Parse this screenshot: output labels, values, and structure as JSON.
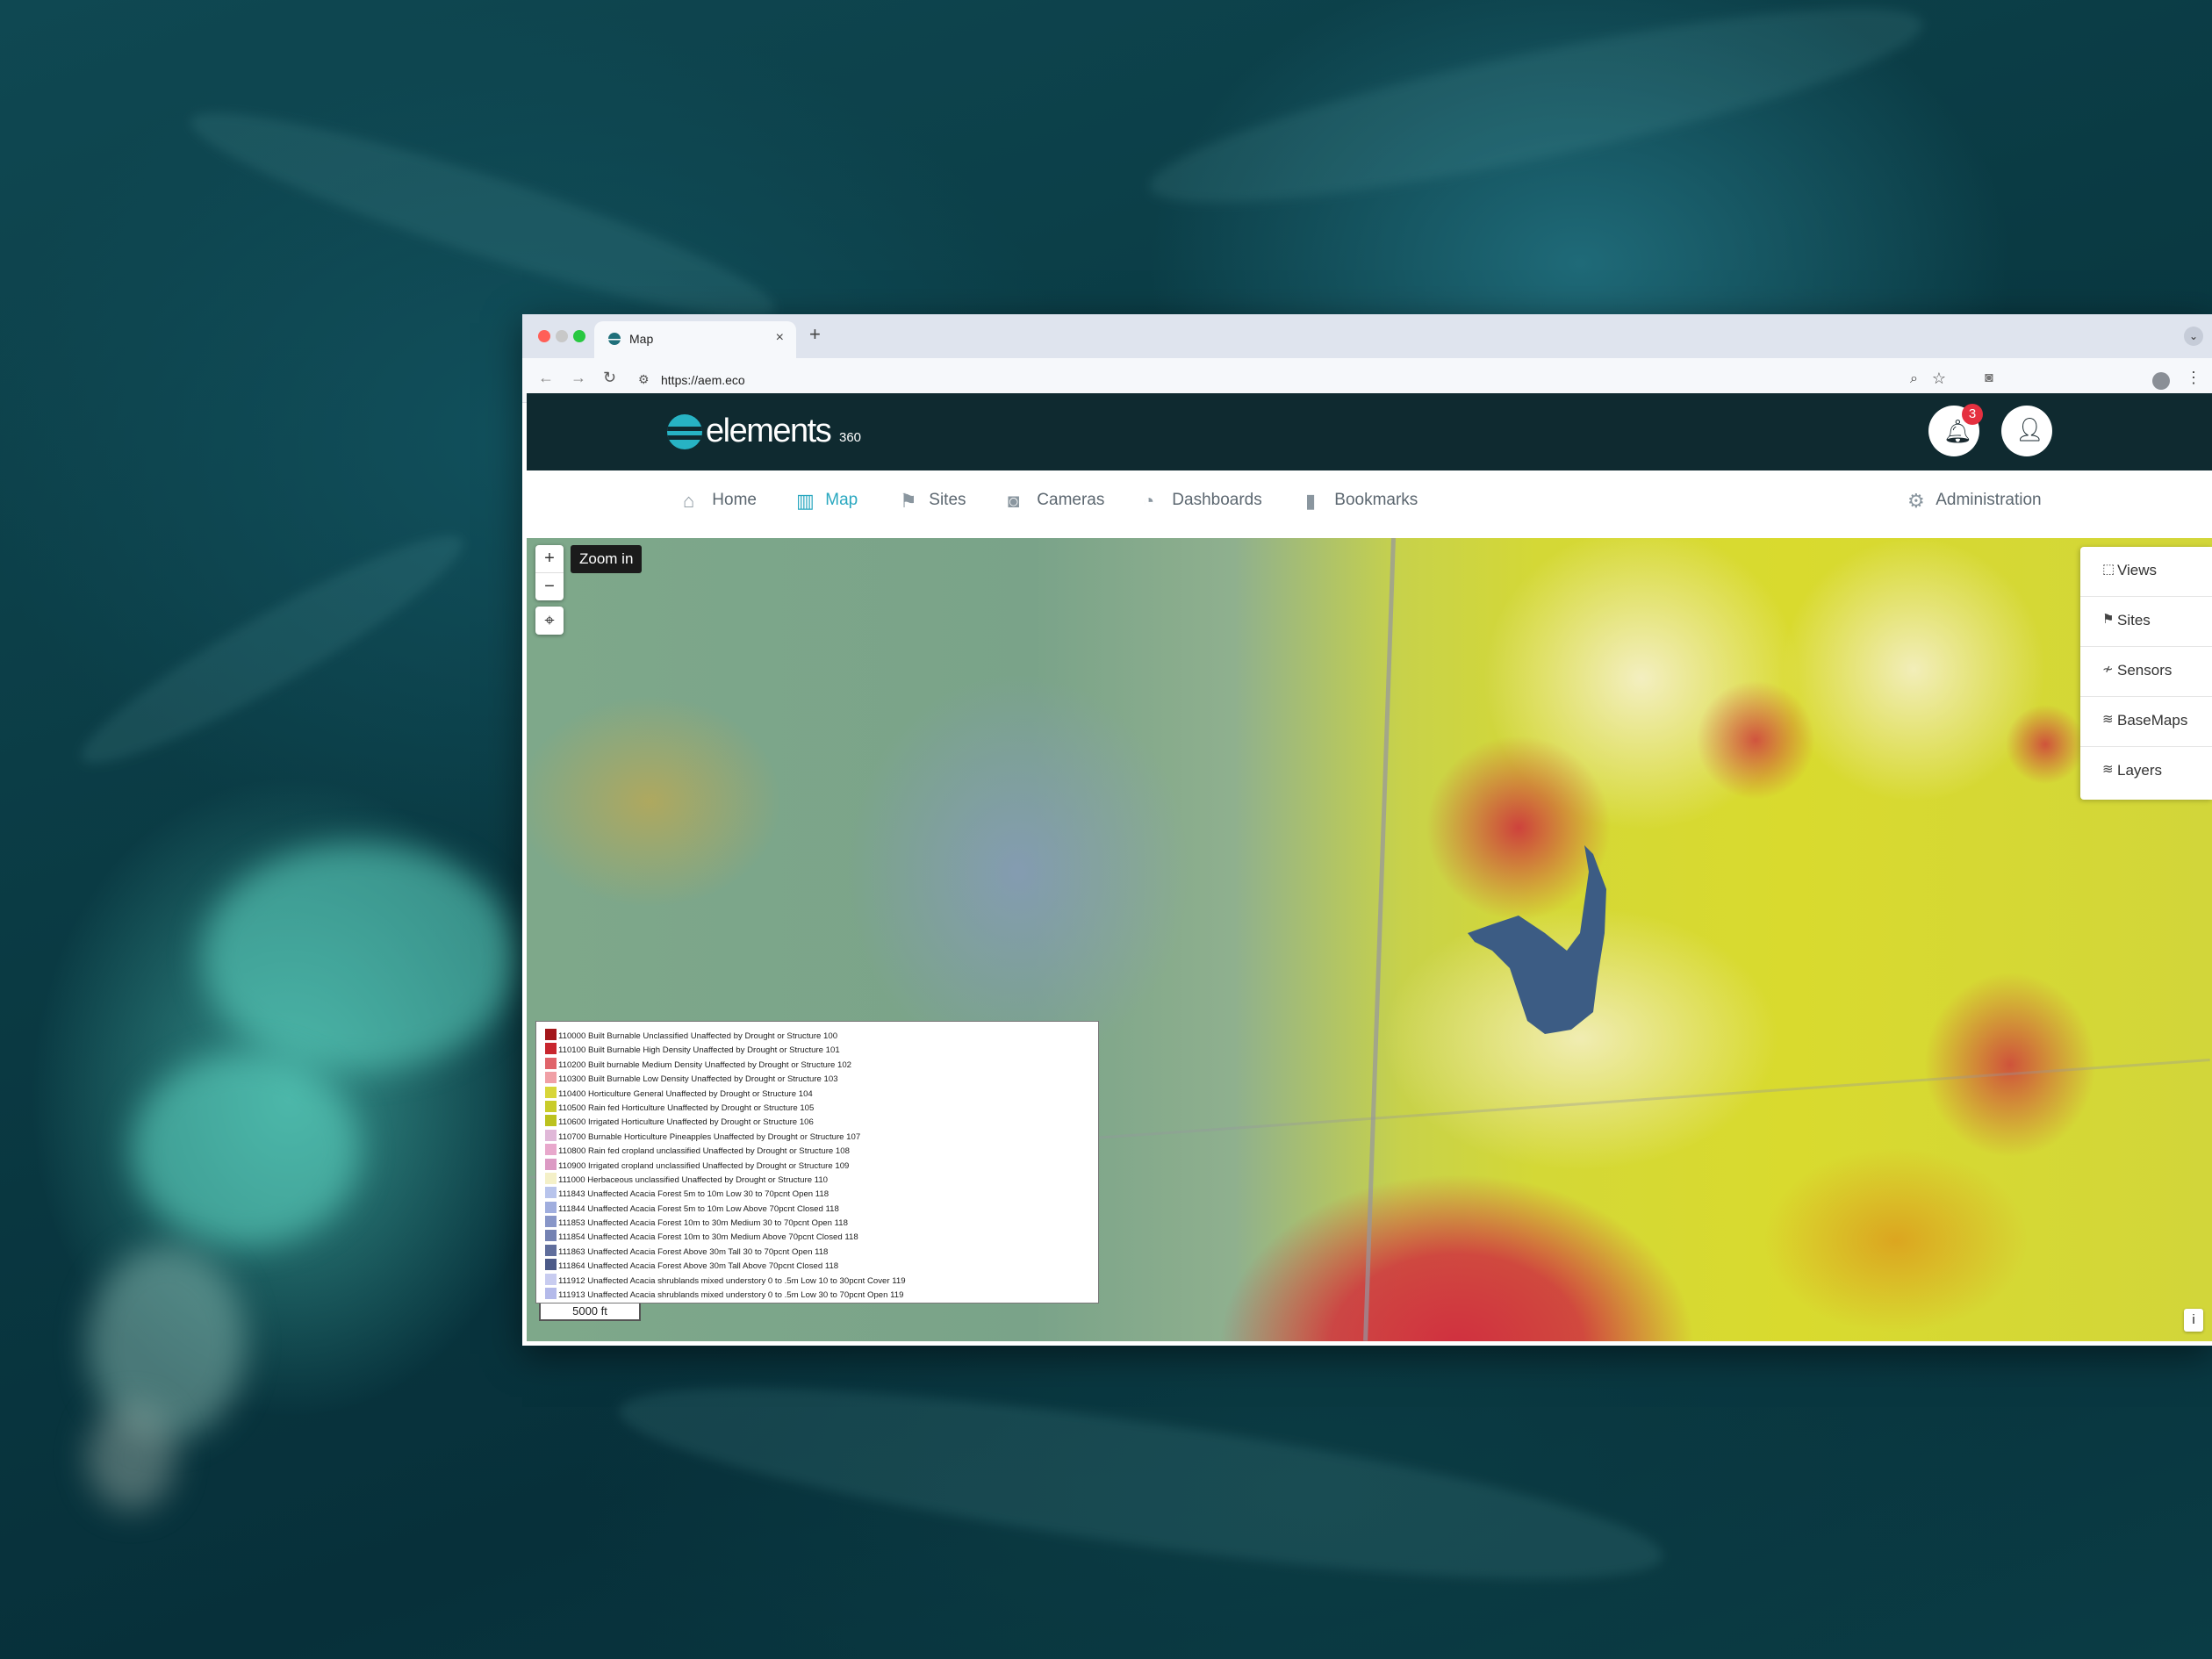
{
  "browser": {
    "tab_title": "Map",
    "tab_close": "×",
    "new_tab": "+",
    "tab_menu": "⌄",
    "url": "https://aem.eco",
    "back_glyph": "←",
    "forward_glyph": "→",
    "reload_glyph": "↻",
    "traffic_lights": [
      "#ff5f57",
      "#c8c8c8",
      "#28c840"
    ]
  },
  "app": {
    "logo_text": "elements",
    "logo_suffix": "360",
    "notification_count": "3",
    "brand_color": "#0f2a30",
    "accent_color": "#2aa8c0"
  },
  "nav": {
    "items": [
      {
        "label": "Home",
        "icon": "home-icon",
        "glyph": "⌂"
      },
      {
        "label": "Map",
        "icon": "map-icon",
        "glyph": "▥",
        "active": true
      },
      {
        "label": "Sites",
        "icon": "flag-icon",
        "glyph": "⚑"
      },
      {
        "label": "Cameras",
        "icon": "camera-icon",
        "glyph": "◙"
      },
      {
        "label": "Dashboards",
        "icon": "gauge-icon",
        "glyph": "◔"
      },
      {
        "label": "Bookmarks",
        "icon": "bookmark-icon",
        "glyph": "▮"
      }
    ],
    "admin": {
      "label": "Administration",
      "icon": "gear-icon",
      "glyph": "⚙"
    }
  },
  "map": {
    "zoom_in": "+",
    "zoom_out": "−",
    "locate_glyph": "⌖",
    "tooltip": "Zoom in",
    "scale_label": "5000 ft",
    "info_label": "i",
    "side_panel": [
      {
        "label": "Views",
        "icon": "views-icon",
        "glyph": "⬚"
      },
      {
        "label": "Sites",
        "icon": "flag-icon",
        "glyph": "⚑"
      },
      {
        "label": "Sensors",
        "icon": "sensor-icon",
        "glyph": "≁"
      },
      {
        "label": "BaseMaps",
        "icon": "layers-icon",
        "glyph": "≋"
      },
      {
        "label": "Layers",
        "icon": "layers-icon",
        "glyph": "≋"
      }
    ],
    "legend": [
      {
        "color": "#a3161a",
        "label": "110000 Built Burnable Unclassified Unaffected by Drought or Structure 100"
      },
      {
        "color": "#c8262e",
        "label": "110100 Built Burnable High Density Unaffected by Drought or Structure 101"
      },
      {
        "color": "#e0646a",
        "label": "110200 Built burnable Medium Density Unaffected by Drought or Structure 102"
      },
      {
        "color": "#f0a0a6",
        "label": "110300 Built Burnable Low Density Unaffected by Drought or Structure 103"
      },
      {
        "color": "#d8d63a",
        "label": "110400 Horticulture General Unaffected by Drought or Structure 104"
      },
      {
        "color": "#c9cc2a",
        "label": "110500 Rain fed Horticulture Unaffected by Drought or Structure 105"
      },
      {
        "color": "#bcc21e",
        "label": "110600 Irrigated Horticulture Unaffected by Drought or Structure 106"
      },
      {
        "color": "#e0b8d8",
        "label": "110700 Burnable Horticulture Pineapples Unaffected by Drought or Structure 107"
      },
      {
        "color": "#e8a8cc",
        "label": "110800 Rain fed cropland unclassified Unaffected by Drought or Structure 108"
      },
      {
        "color": "#dc9ac4",
        "label": "110900 Irrigated cropland unclassified Unaffected by Drought or Structure 109"
      },
      {
        "color": "#f4f0c8",
        "label": "111000 Herbaceous unclassified Unaffected by Drought or Structure 110"
      },
      {
        "color": "#b8c4ec",
        "label": "111843 Unaffected Acacia Forest 5m to 10m Low 30 to 70pcnt Open 118"
      },
      {
        "color": "#a0aede",
        "label": "111844 Unaffected Acacia Forest 5m to 10m Low Above 70pcnt Closed 118"
      },
      {
        "color": "#8896c8",
        "label": "111853 Unaffected Acacia Forest 10m to 30m Medium 30 to 70pcnt Open 118"
      },
      {
        "color": "#7482b2",
        "label": "111854 Unaffected Acacia Forest 10m to 30m Medium Above 70pcnt Closed 118"
      },
      {
        "color": "#606e9c",
        "label": "111863 Unaffected Acacia Forest Above 30m Tall 30 to 70pcnt Open 118"
      },
      {
        "color": "#4c5a88",
        "label": "111864 Unaffected Acacia Forest Above 30m Tall Above 70pcnt Closed 118"
      },
      {
        "color": "#c8ccf0",
        "label": "111912 Unaffected Acacia shrublands mixed understory 0 to .5m Low 10 to 30pcnt Cover 119"
      },
      {
        "color": "#b4baea",
        "label": "111913 Unaffected Acacia shrublands mixed understory 0 to .5m Low 30 to 70pcnt Open 119"
      }
    ]
  }
}
